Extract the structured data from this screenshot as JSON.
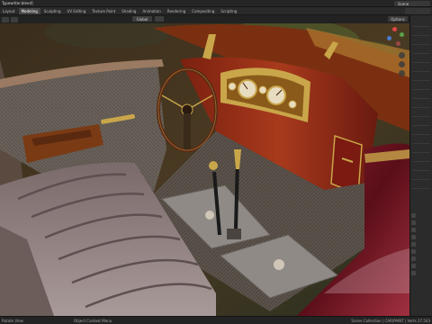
{
  "app": {
    "title": "Typewriter.blend]",
    "scene_label": "Scene"
  },
  "workspace_tabs": [
    {
      "label": "Layout",
      "active": false
    },
    {
      "label": "Modeling",
      "active": true
    },
    {
      "label": "Sculpting",
      "active": false
    },
    {
      "label": "UV Editing",
      "active": false
    },
    {
      "label": "Texture Paint",
      "active": false
    },
    {
      "label": "Shading",
      "active": false
    },
    {
      "label": "Animation",
      "active": false
    },
    {
      "label": "Rendering",
      "active": false
    },
    {
      "label": "Compositing",
      "active": false
    },
    {
      "label": "Scripting",
      "active": false
    }
  ],
  "viewport_header": {
    "transform_orientation": "Global",
    "options_label": "Options"
  },
  "statusbar": {
    "left": "Rotate View",
    "middle": "Object Context Menu",
    "right": "Scene Collection | CAR/PAINT | Verts 27,543"
  },
  "colors": {
    "accent": "#4772b3",
    "paint": "#6b1420",
    "leather": "#8a7a7a",
    "wood": "#7a3a14",
    "brass": "#c9a64a"
  },
  "icons": [
    "cursor-icon",
    "snap-icon",
    "nav-gizmo",
    "camera-icon",
    "hand-icon",
    "zoom-icon"
  ]
}
